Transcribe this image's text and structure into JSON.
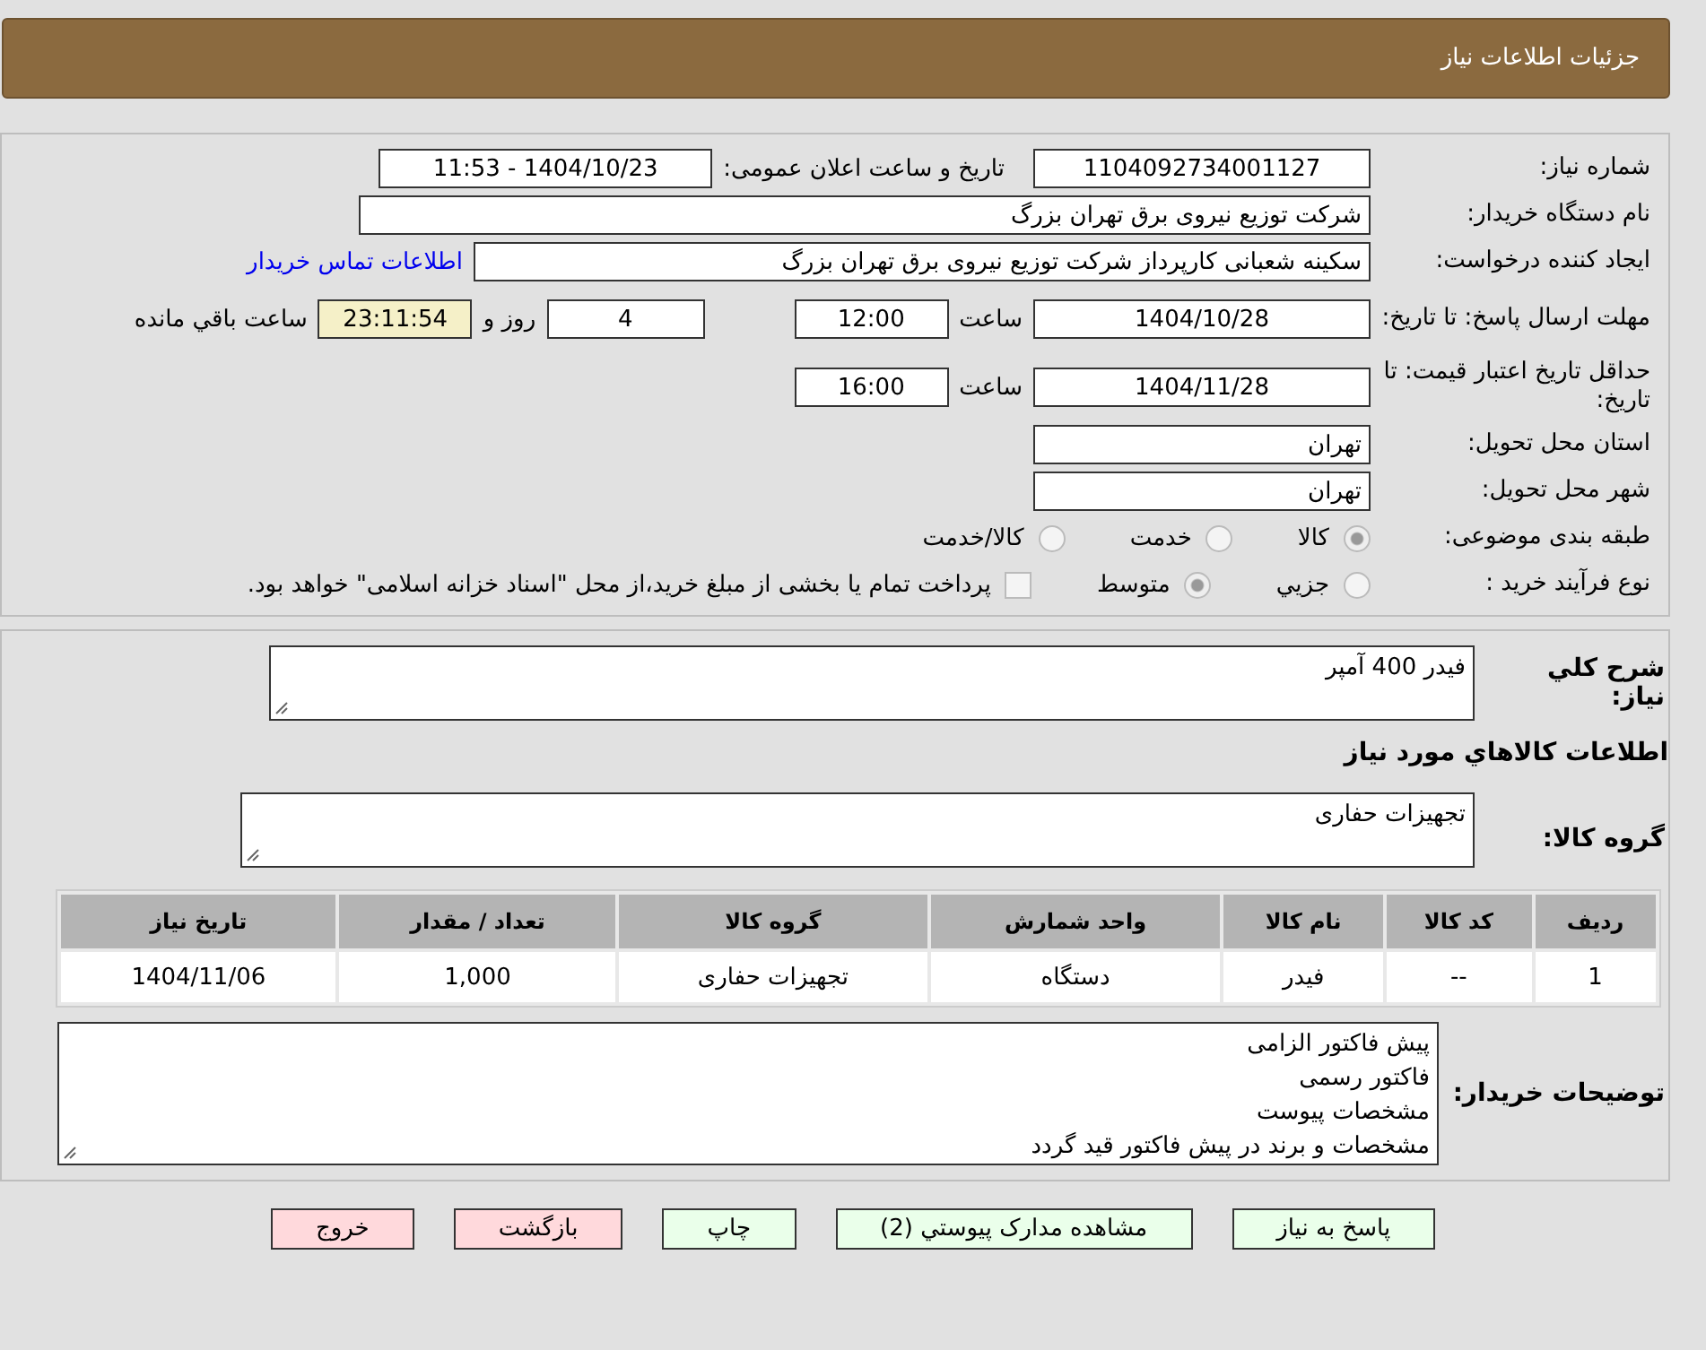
{
  "header": {
    "title": "جزئیات اطلاعات نیاز"
  },
  "fields": {
    "need_number": {
      "label": "شماره نیاز:",
      "value": "1104092734001127"
    },
    "announce": {
      "label": "تاریخ و ساعت اعلان عمومی:",
      "value": "1404/10/23 - 11:53"
    },
    "buyer": {
      "label": "نام دستگاه خریدار:",
      "value": "شرکت توزیع نیروی برق تهران بزرگ"
    },
    "creator": {
      "label": "ایجاد کننده درخواست:",
      "value": "سکینه شعبانی کارپرداز شرکت توزیع نیروی برق تهران بزرگ",
      "link": "اطلاعات تماس خریدار"
    },
    "deadline": {
      "label": "مهلت ارسال پاسخ: تا تاریخ:",
      "date": "1404/10/28",
      "time_label": "ساعت",
      "time": "12:00",
      "days": "4",
      "days_label": "روز و",
      "remaining": "23:11:54",
      "remaining_label": "ساعت باقي مانده"
    },
    "validity": {
      "label": "حداقل تاریخ اعتبار قیمت: تا تاریخ:",
      "date": "1404/11/28",
      "time_label": "ساعت",
      "time": "16:00"
    },
    "province": {
      "label": "استان محل تحویل:",
      "value": "تهران"
    },
    "city": {
      "label": "شهر محل تحویل:",
      "value": "تهران"
    }
  },
  "category": {
    "label": "طبقه بندی موضوعی:",
    "options": [
      {
        "label": "کالا",
        "selected": true
      },
      {
        "label": "خدمت",
        "selected": false
      },
      {
        "label": "کالا/خدمت",
        "selected": false
      }
    ]
  },
  "process": {
    "label": "نوع فرآیند خرید :",
    "options": [
      {
        "label": "جزيي",
        "selected": false
      },
      {
        "label": "متوسط",
        "selected": true
      }
    ],
    "treasury": {
      "label": "پرداخت تمام یا بخشی از مبلغ خرید،از محل \"اسناد خزانه اسلامی\" خواهد بود.",
      "checked": false
    }
  },
  "description": {
    "label": "شرح کلي نياز:",
    "value": "فیدر 400 آمپر"
  },
  "goods_title": "اطلاعات کالاهاي مورد نياز",
  "goods_group": {
    "label": "گروه کالا:",
    "value": "تجهیزات حفاری"
  },
  "table": {
    "columns": [
      "رديف",
      "کد کالا",
      "نام کالا",
      "واحد شمارش",
      "گروه کالا",
      "تعداد / مقدار",
      "تاریخ نیاز"
    ],
    "rows": [
      [
        "1",
        "--",
        "فیدر",
        "دستگاه",
        "تجهیزات حفاری",
        "1,000",
        "1404/11/06"
      ]
    ]
  },
  "buyer_notes": {
    "label": "توضیحات خریدار:",
    "lines": [
      "پیش فاکتور الزامی",
      "فاکتور رسمی",
      "مشخصات پیوست",
      "مشخصات و برند در پیش فاکتور قید گردد"
    ]
  },
  "buttons": [
    {
      "label": "پاسخ به نیاز",
      "kind": "primary"
    },
    {
      "label": "مشاهده مدارک پیوستي (2)",
      "kind": "primary"
    },
    {
      "label": "چاپ",
      "kind": "primary"
    },
    {
      "label": "بازگشت",
      "kind": "danger"
    },
    {
      "label": "خروج",
      "kind": "danger"
    }
  ]
}
